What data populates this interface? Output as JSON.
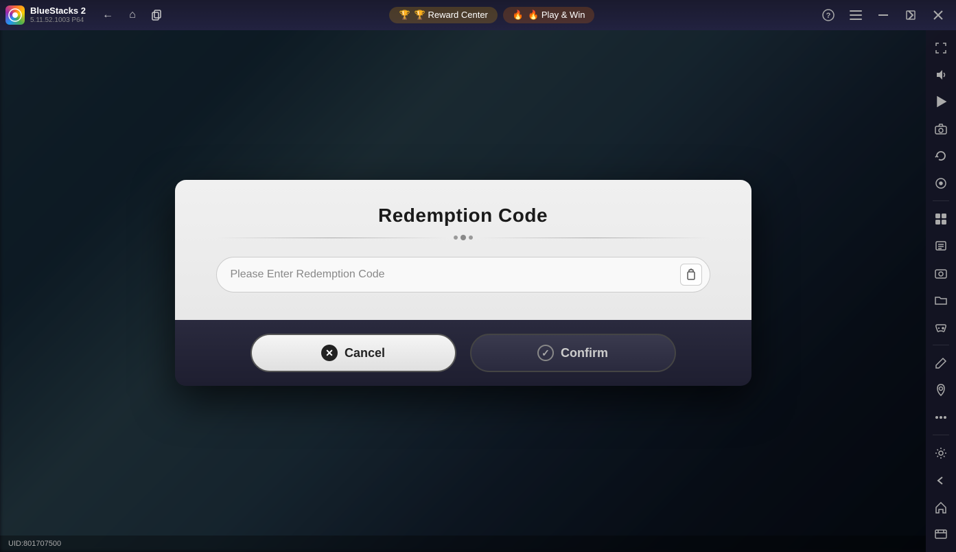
{
  "app": {
    "name": "BlueStacks 2",
    "version": "5.11.52.1003  P64"
  },
  "topbar": {
    "nav_back": "←",
    "nav_home": "⌂",
    "nav_copy": "⧉",
    "reward_center": "🏆 Reward Center",
    "play_win": "🔥 Play & Win",
    "help_icon": "?",
    "menu_icon": "≡",
    "minimize_icon": "—",
    "restore_icon": "⬜",
    "close_icon": "✕",
    "expand_icon": "⇥"
  },
  "modal": {
    "title": "Redemption Code",
    "input_placeholder": "Please Enter Redemption Code",
    "cancel_label": "Cancel",
    "confirm_label": "Confirm"
  },
  "sidebar": {
    "icons": [
      "⛶",
      "🔊",
      "▶",
      "📷",
      "🔄",
      "⊙",
      "📦",
      "📋",
      "📸",
      "📁",
      "✈",
      "⊡",
      "✏",
      "📍",
      "⋯",
      "⚙",
      "←",
      "⌂",
      "📋"
    ]
  },
  "bottom": {
    "uid": "UID:801707500"
  }
}
